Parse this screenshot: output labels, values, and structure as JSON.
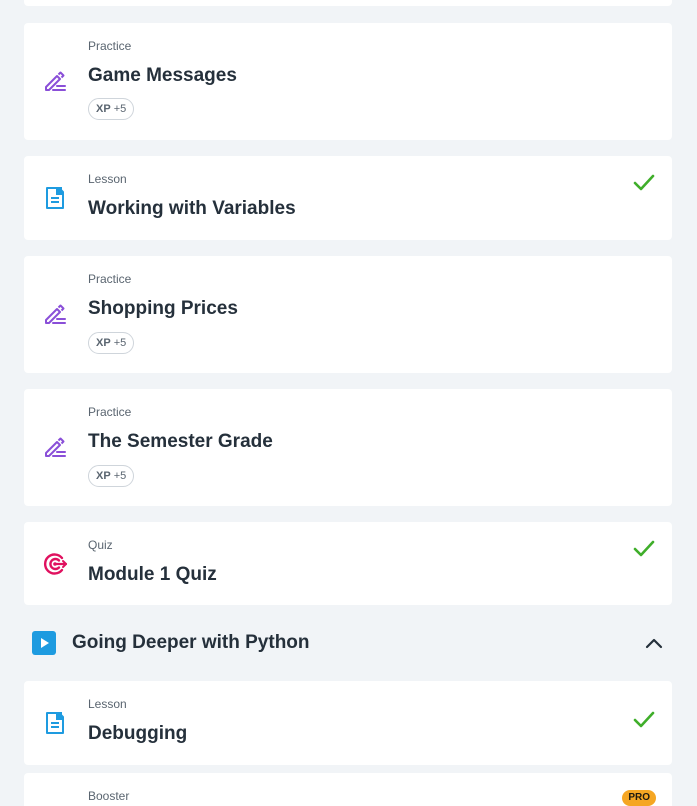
{
  "lessons": [
    {
      "type": "",
      "title": "",
      "icon": "none",
      "completed": false
    },
    {
      "type": "Practice",
      "title": "Game Messages",
      "icon": "pencil-icon",
      "xp_label": "XP",
      "xp_value": "+5",
      "completed": false
    },
    {
      "type": "Lesson",
      "title": "Working with Variables",
      "icon": "lesson-document-icon",
      "completed": true
    },
    {
      "type": "Practice",
      "title": "Shopping Prices",
      "icon": "pencil-icon",
      "xp_label": "XP",
      "xp_value": "+5",
      "completed": false
    },
    {
      "type": "Practice",
      "title": "The Semester Grade",
      "icon": "pencil-icon",
      "xp_label": "XP",
      "xp_value": "+5",
      "completed": false
    },
    {
      "type": "Quiz",
      "title": "Module 1 Quiz",
      "icon": "target-icon",
      "completed": true
    }
  ],
  "module": {
    "title": "Going Deeper with Python",
    "icon": "play-icon",
    "expanded": true,
    "items": [
      {
        "type": "Lesson",
        "title": "Debugging",
        "icon": "lesson-document-icon",
        "completed": true
      },
      {
        "type": "Booster",
        "title": "",
        "pro_label": "PRO",
        "completed": false
      }
    ]
  },
  "colors": {
    "background": "#f1f4f7",
    "card": "#ffffff",
    "practice_icon": "#8a4fd8",
    "lesson_icon": "#1e9be0",
    "quiz_icon": "#e0115f",
    "check": "#3fae2a",
    "module_icon": "#1e9be0",
    "pro_badge": "#f5a623"
  }
}
